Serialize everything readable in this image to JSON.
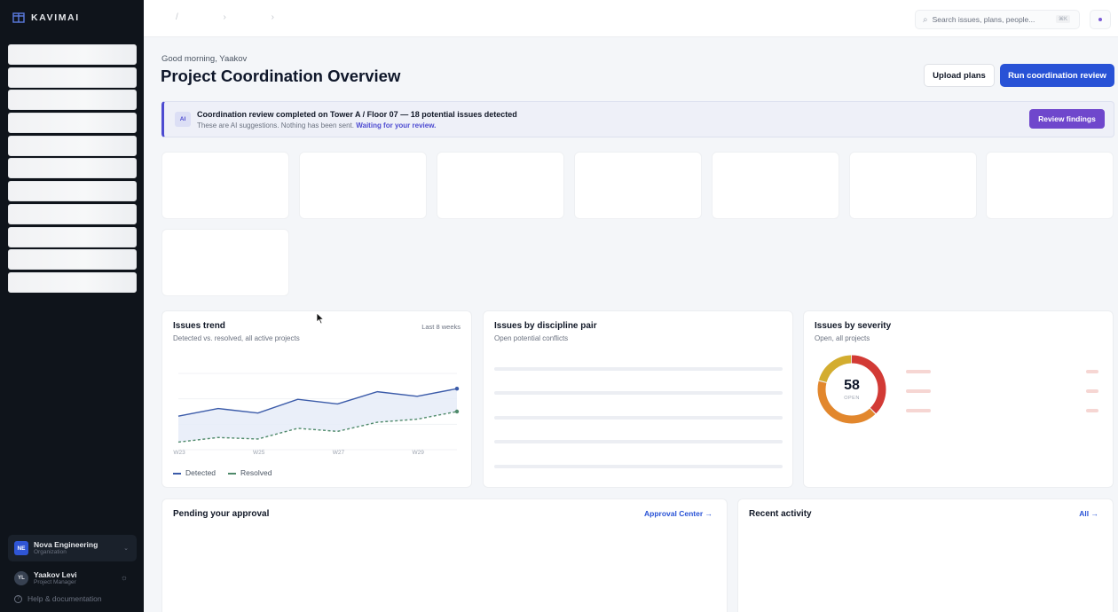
{
  "app": {
    "brand": "KAVIMAI"
  },
  "sidebar": {
    "org": {
      "initials": "NE",
      "name": "Nova Engineering",
      "role": "Organization"
    },
    "user": {
      "initials": "YL",
      "name": "Yaakov Levi",
      "role": "Project Manager"
    },
    "help_label": "Help & documentation"
  },
  "topbar": {
    "breadcrumb_separators": "/ › ›",
    "search": {
      "placeholder": "Search issues, plans, people...",
      "shortcut": "⌘K"
    }
  },
  "header": {
    "greeting": "Good morning, Yaakov",
    "title": "Project Coordination Overview",
    "upload_label": "Upload plans",
    "run_label": "Run coordination review"
  },
  "ai_banner": {
    "tag": "AI",
    "title": "Coordination review completed on Tower A / Floor 07 — 18 potential issues detected",
    "subtitle": "These are AI suggestions. Nothing has been sent.",
    "highlight": "Waiting for your review.",
    "button": "Review findings"
  },
  "issues_trend": {
    "title": "Issues trend",
    "subtitle": "Detected vs. resolved, all active projects",
    "range": "Last 8 weeks",
    "legend_detected": "Detected",
    "legend_resolved": "Resolved"
  },
  "discipline": {
    "title": "Issues by discipline pair",
    "subtitle": "Open potential conflicts"
  },
  "severity": {
    "title": "Issues by severity",
    "subtitle": "Open, all projects",
    "total": "58",
    "total_label": "OPEN"
  },
  "approvals": {
    "title": "Pending your approval",
    "link": "Approval Center →"
  },
  "activity": {
    "title": "Recent activity",
    "link": "All →"
  },
  "colors": {
    "detected": "#3b5ba9",
    "resolved": "#4f8a6b",
    "primary": "#2852d6",
    "ai": "#6f47cc"
  },
  "chart_data": {
    "type": "line",
    "x": [
      "W23",
      "W24",
      "W25",
      "W26",
      "W27",
      "W28",
      "W29",
      "W30"
    ],
    "tick_labels": [
      "W23",
      "W25",
      "W27",
      "W29"
    ],
    "series": [
      {
        "name": "Detected",
        "values": [
          22,
          27,
          24,
          33,
          30,
          38,
          35,
          40
        ]
      },
      {
        "name": "Resolved",
        "values": [
          5,
          8,
          7,
          14,
          12,
          18,
          20,
          25
        ]
      }
    ],
    "ylim": [
      0,
      50
    ],
    "grid": true
  },
  "severity_chart": {
    "type": "pie",
    "segments": [
      {
        "value": 22,
        "color": "#d23a35"
      },
      {
        "value": 24,
        "color": "#e2872d"
      },
      {
        "value": 12,
        "color": "#d3ad2f"
      }
    ]
  }
}
